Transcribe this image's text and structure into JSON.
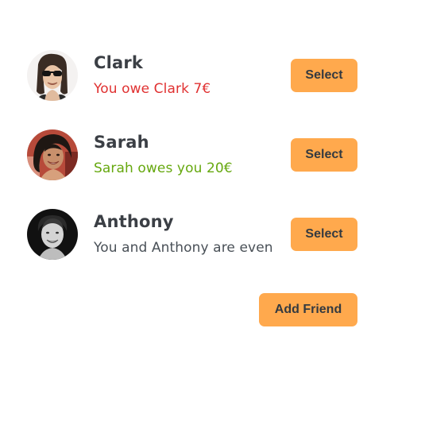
{
  "friends": [
    {
      "name": "Clark",
      "balance_text": "You owe Clark 7€",
      "status": "owe",
      "status_color": "#e03131",
      "avatar_icon": "avatar-photo",
      "select_label": "Select"
    },
    {
      "name": "Sarah",
      "balance_text": "Sarah owes you 20€",
      "status": "owed",
      "status_color": "#66a80f",
      "avatar_icon": "avatar-photo",
      "select_label": "Select"
    },
    {
      "name": "Anthony",
      "balance_text": "You and Anthony are even",
      "status": "even",
      "status_color": "#495057",
      "avatar_icon": "avatar-photo",
      "select_label": "Select"
    }
  ],
  "add_friend_label": "Add Friend",
  "colors": {
    "button": "#ffa94d",
    "button_text": "#343a40",
    "name_text": "#3b3f45"
  }
}
